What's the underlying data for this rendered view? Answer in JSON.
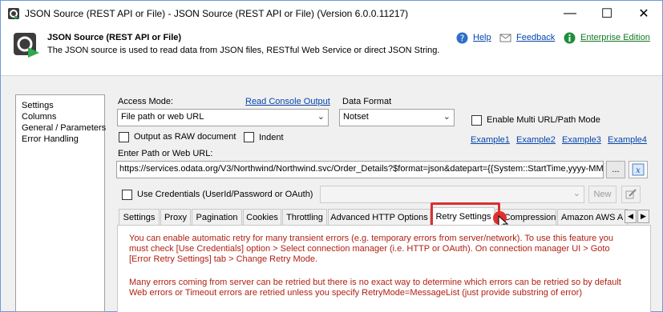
{
  "window": {
    "title": "JSON Source (REST API or File) - JSON Source (REST API or File) (Version 6.0.0.11217)",
    "minimize_glyph": "—",
    "maximize_glyph": "☐",
    "close_glyph": "✕"
  },
  "header": {
    "title": "JSON Source (REST API or File)",
    "description": "The JSON source is used to read data from JSON files, RESTful Web Service or direct JSON String.",
    "help_label": "Help",
    "feedback_label": "Feedback",
    "edition_label": "Enterprise Edition"
  },
  "sidebar": {
    "items": [
      {
        "label": "Settings"
      },
      {
        "label": "Columns"
      },
      {
        "label": "General / Parameters"
      },
      {
        "label": "Error Handling"
      }
    ]
  },
  "settings": {
    "access_mode_label": "Access Mode:",
    "read_console_label": "Read Console Output",
    "access_mode_value": "File path or web URL",
    "data_format_label": "Data Format",
    "data_format_value": "Notset",
    "multi_url_label": "Enable Multi URL/Path Mode",
    "output_raw_label": "Output as RAW document",
    "indent_label": "Indent",
    "examples": [
      "Example1",
      "Example2",
      "Example3",
      "Example4"
    ],
    "path_label": "Enter Path or Web URL:",
    "path_value": "https://services.odata.org/V3/Northwind/Northwind.svc/Order_Details?$format=json&datepart={{System::StartTime,yyyy-MM-",
    "browse_label": "...",
    "use_credentials_label": "Use Credentials (UserId/Password or OAuth)",
    "new_button_label": "New"
  },
  "tabs": [
    {
      "label": "Settings"
    },
    {
      "label": "Proxy"
    },
    {
      "label": "Pagination"
    },
    {
      "label": "Cookies"
    },
    {
      "label": "Throttling"
    },
    {
      "label": "Advanced HTTP Options"
    },
    {
      "label": "Retry Settings"
    },
    {
      "label": "Compression"
    },
    {
      "label": "Amazon AWS A"
    }
  ],
  "retry_panel": {
    "paragraph1": "You can enable automatic retry for many transient errors (e.g. temporary errors from server/network). To use this feature you must check [Use Credentials] option > Select connection manager (i.e. HTTP or OAuth). On connection manager UI > Goto [Error Retry Settings] tab > Change Retry Mode.",
    "paragraph2": "Many errors coming from server can be retried but there is no exact way to determine which errors can be retried so by default Web errors or Timeout errors are retried unless you specify RetryMode=MessageList (just provide substring of error)"
  },
  "colors": {
    "accent_link": "#0645ad",
    "edition_green": "#117a22",
    "highlight_red": "#d9312f",
    "panel_text_red": "#b01f12"
  },
  "icons": [
    "app-icon",
    "help-icon",
    "feedback-icon",
    "info-icon",
    "dropdown-arrow-icon",
    "expression-icon",
    "edit-icon",
    "cursor-icon"
  ]
}
